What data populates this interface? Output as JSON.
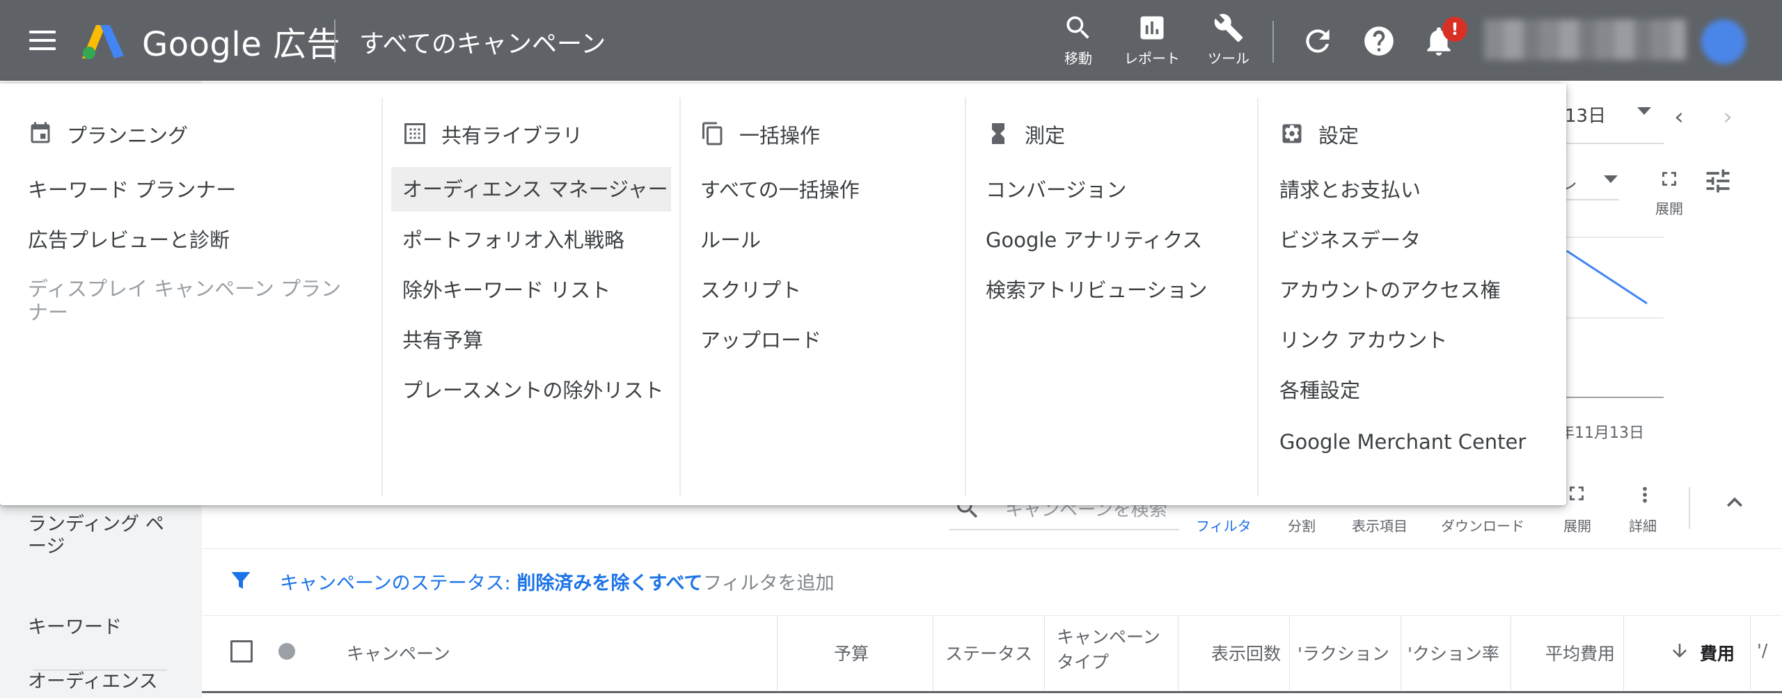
{
  "topbar": {
    "brand": "Google 広告",
    "page_title": "すべてのキャンペーン",
    "tools": [
      {
        "icon": "search-icon",
        "label": "移動"
      },
      {
        "icon": "report-chart-icon",
        "label": "レポート"
      },
      {
        "icon": "wrench-icon",
        "label": "ツール"
      }
    ],
    "notification_badge": "!"
  },
  "background": {
    "date_range": "13日",
    "chart_date": "年11月13日",
    "chart_filter_fragment": "レ",
    "expand_label": "展開",
    "left_rail": [
      "ランディング ページ",
      "キーワード",
      "オーディエンス"
    ],
    "search_placeholder": "キャンペーンを検索",
    "toolbar": [
      "フィルタ",
      "分割",
      "表示項目",
      "ダウンロード",
      "展開",
      "詳細"
    ],
    "filter": {
      "label_prefix": "キャンペーンのステータス: ",
      "label_value": "削除済みを除くすべて",
      "add": "フィルタを追加"
    },
    "columns": {
      "campaign": "キャンペーン",
      "budget": "予算",
      "status": "ステータス",
      "type_line1": "キャンペーン",
      "type_line2": "タイプ",
      "impressions": "表示回数",
      "interactions": "'ラクション",
      "interaction_rate": "'クション率",
      "avg_cost": "平均費用",
      "cost": "費用",
      "more": "'/"
    }
  },
  "panel": {
    "columns": [
      {
        "header": "プランニング",
        "icon": "calendar-icon",
        "items": [
          "キーワード プランナー",
          "広告プレビューと診断",
          "ディスプレイ キャンペーン プランナー"
        ]
      },
      {
        "header": "共有ライブラリ",
        "icon": "library-grid-icon",
        "items": [
          "オーディエンス マネージャー",
          "ポートフォリオ入札戦略",
          "除外キーワード リスト",
          "共有予算",
          "プレースメントの除外リスト"
        ]
      },
      {
        "header": "一括操作",
        "icon": "copy-stack-icon",
        "items": [
          "すべての一括操作",
          "ルール",
          "スクリプト",
          "アップロード"
        ]
      },
      {
        "header": "測定",
        "icon": "hourglass-icon",
        "items": [
          "コンバージョン",
          "Google アナリティクス",
          "検索アトリビューション"
        ]
      },
      {
        "header": "設定",
        "icon": "settings-gear-icon",
        "items": [
          "請求とお支払い",
          "ビジネスデータ",
          "アカウントのアクセス権",
          "リンク アカウント",
          "各種設定",
          "Google Merchant Center"
        ]
      }
    ]
  }
}
